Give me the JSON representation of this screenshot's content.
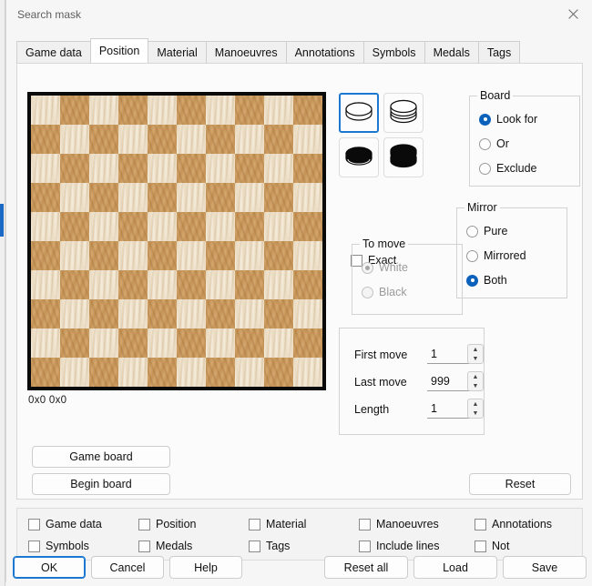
{
  "window": {
    "title": "Search mask",
    "close_icon": "close-icon"
  },
  "tabs": [
    {
      "label": "Game data",
      "active": false
    },
    {
      "label": "Position",
      "active": true
    },
    {
      "label": "Material",
      "active": false
    },
    {
      "label": "Manoeuvres",
      "active": false
    },
    {
      "label": "Annotations",
      "active": false
    },
    {
      "label": "Symbols",
      "active": false
    },
    {
      "label": "Medals",
      "active": false
    },
    {
      "label": "Tags",
      "active": false
    }
  ],
  "board": {
    "rows": 10,
    "cols": 10,
    "status": "0x0  0x0",
    "light_color": "#eee0c8",
    "dark_color": "#cb9a5c",
    "border_color": "#0a0a0a"
  },
  "board_buttons": {
    "game_board": "Game board",
    "begin_board": "Begin board"
  },
  "reset_button": "Reset",
  "piece_palette": [
    {
      "name": "white-man-piece",
      "icon": "white-man-icon",
      "selected": true
    },
    {
      "name": "white-king-piece",
      "icon": "white-king-icon",
      "selected": false
    },
    {
      "name": "black-man-piece",
      "icon": "black-man-icon",
      "selected": false
    },
    {
      "name": "black-king-piece",
      "icon": "black-king-icon",
      "selected": false
    }
  ],
  "board_group": {
    "title": "Board",
    "options": [
      {
        "label": "Look for",
        "checked": true
      },
      {
        "label": "Or",
        "checked": false
      },
      {
        "label": "Exclude",
        "checked": false
      }
    ]
  },
  "mirror_group": {
    "title": "Mirror",
    "options": [
      {
        "label": "Pure",
        "checked": false
      },
      {
        "label": "Mirrored",
        "checked": false
      },
      {
        "label": "Both",
        "checked": true
      }
    ]
  },
  "exact": {
    "label": "Exact",
    "checked": false
  },
  "to_move_group": {
    "title": "To move",
    "disabled": true,
    "options": [
      {
        "label": "White",
        "checked": true
      },
      {
        "label": "Black",
        "checked": false
      }
    ]
  },
  "move_fields": [
    {
      "label": "First move",
      "value": "1"
    },
    {
      "label": "Last move",
      "value": "999"
    },
    {
      "label": "Length",
      "value": "1"
    }
  ],
  "filter_checkboxes": [
    {
      "label": "Game data",
      "checked": false
    },
    {
      "label": "Position",
      "checked": false
    },
    {
      "label": "Material",
      "checked": false
    },
    {
      "label": "Manoeuvres",
      "checked": false
    },
    {
      "label": "Annotations",
      "checked": false
    },
    {
      "label": "Symbols",
      "checked": false
    },
    {
      "label": "Medals",
      "checked": false
    },
    {
      "label": "Tags",
      "checked": false
    },
    {
      "label": "Include lines",
      "checked": false
    },
    {
      "label": "Not",
      "checked": false
    }
  ],
  "footer": {
    "ok": "OK",
    "cancel": "Cancel",
    "help": "Help",
    "reset_all": "Reset all",
    "load": "Load",
    "save": "Save"
  },
  "accent_color": "#1b78d0"
}
